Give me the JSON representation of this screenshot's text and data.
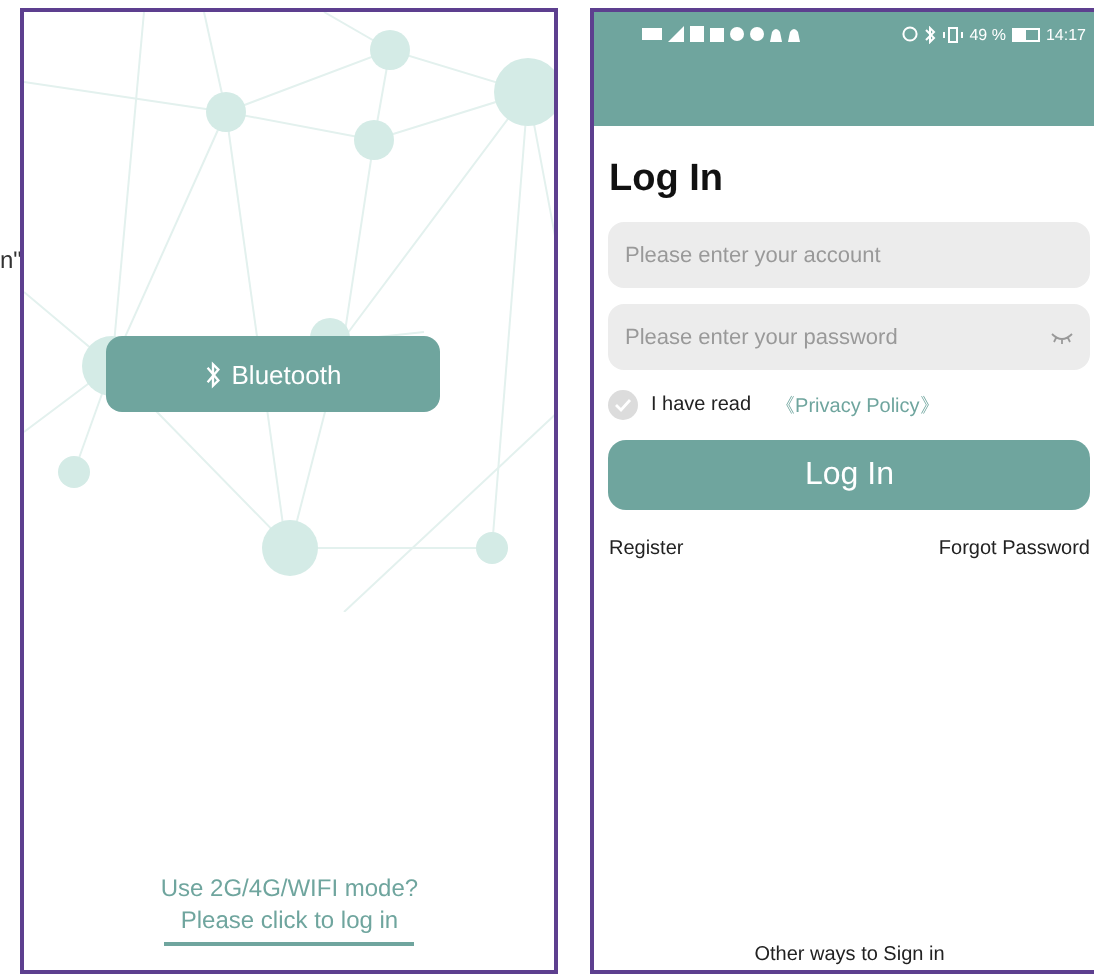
{
  "edge_fragment": "n\"",
  "left_screen": {
    "bluetooth_button": {
      "label": "Bluetooth"
    },
    "login_prompt": {
      "question": "Use 2G/4G/WIFI mode?",
      "link": "Please click to log in"
    }
  },
  "right_screen": {
    "status_bar": {
      "battery_percent": "49 %",
      "time": "14:17"
    },
    "title": "Log In",
    "account_field": {
      "placeholder": "Please enter your account"
    },
    "password_field": {
      "placeholder": "Please enter your password"
    },
    "agreement": {
      "checked": false,
      "text": "I have read",
      "link": "《Privacy Policy》"
    },
    "login_button": {
      "label": "Log In"
    },
    "links": [
      "Register",
      "Forgot Password"
    ],
    "footer": "Other ways to Sign in"
  }
}
